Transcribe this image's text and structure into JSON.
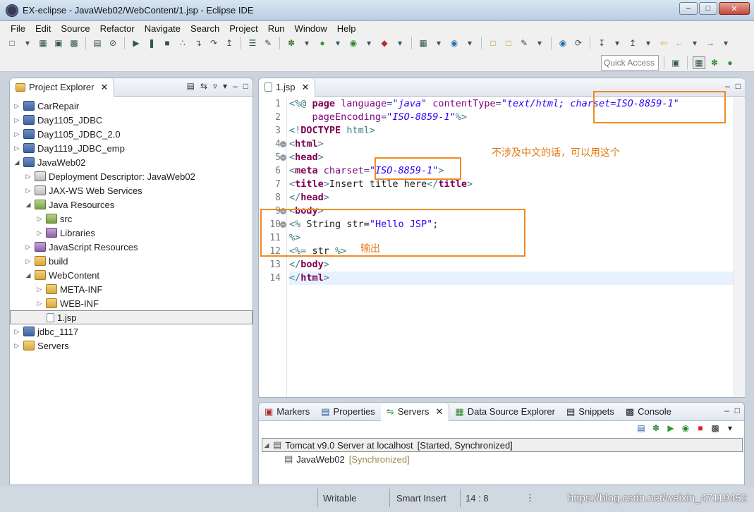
{
  "window": {
    "title": "EX-eclipse - JavaWeb02/WebContent/1.jsp - Eclipse IDE",
    "minimize": "–",
    "maximize": "□",
    "close": "✕"
  },
  "menu": [
    "File",
    "Edit",
    "Source",
    "Refactor",
    "Navigate",
    "Search",
    "Project",
    "Run",
    "Window",
    "Help"
  ],
  "toolbar": {
    "quick_access": "Quick Access"
  },
  "explorer": {
    "tab_label": "Project Explorer",
    "items": [
      {
        "label": "CarRepair",
        "depth": 0,
        "arrow": "▷",
        "icon": "project-icon"
      },
      {
        "label": "Day1105_JDBC",
        "depth": 0,
        "arrow": "▷",
        "icon": "project-icon"
      },
      {
        "label": "Day1105_JDBC_2.0",
        "depth": 0,
        "arrow": "▷",
        "icon": "project-icon"
      },
      {
        "label": "Day1119_JDBC_emp",
        "depth": 0,
        "arrow": "▷",
        "icon": "project-error-icon"
      },
      {
        "label": "JavaWeb02",
        "depth": 0,
        "arrow": "◢",
        "icon": "project-icon"
      },
      {
        "label": "Deployment Descriptor: JavaWeb02",
        "depth": 1,
        "arrow": "▷",
        "icon": "deployment-descriptor-icon"
      },
      {
        "label": "JAX-WS Web Services",
        "depth": 1,
        "arrow": "▷",
        "icon": "webservices-icon"
      },
      {
        "label": "Java Resources",
        "depth": 1,
        "arrow": "◢",
        "icon": "java-resources-icon"
      },
      {
        "label": "src",
        "depth": 2,
        "arrow": "▷",
        "icon": "source-folder-icon"
      },
      {
        "label": "Libraries",
        "depth": 2,
        "arrow": "▷",
        "icon": "libraries-icon"
      },
      {
        "label": "JavaScript Resources",
        "depth": 1,
        "arrow": "▷",
        "icon": "javascript-resources-icon"
      },
      {
        "label": "build",
        "depth": 1,
        "arrow": "▷",
        "icon": "folder-icon"
      },
      {
        "label": "WebContent",
        "depth": 1,
        "arrow": "◢",
        "icon": "folder-icon"
      },
      {
        "label": "META-INF",
        "depth": 2,
        "arrow": "▷",
        "icon": "folder-icon"
      },
      {
        "label": "WEB-INF",
        "depth": 2,
        "arrow": "▷",
        "icon": "folder-icon"
      },
      {
        "label": "1.jsp",
        "depth": 2,
        "arrow": "",
        "icon": "jsp-file-icon",
        "selected": true
      },
      {
        "label": "jdbc_1117",
        "depth": 0,
        "arrow": "▷",
        "icon": "project-icon"
      },
      {
        "label": "Servers",
        "depth": 0,
        "arrow": "▷",
        "icon": "folder-icon"
      }
    ]
  },
  "editor": {
    "tab_label": "1.jsp",
    "line_numbers": [
      "1",
      "2",
      "3",
      "4",
      "5",
      "6",
      "7",
      "8",
      "9",
      "10",
      "11",
      "12",
      "13",
      "14"
    ],
    "lines": [
      [
        [
          "tg",
          "<%@ "
        ],
        [
          "kw",
          "page "
        ],
        [
          "an",
          "language"
        ],
        [
          "tk",
          "="
        ],
        [
          "av",
          "\"java\""
        ],
        [
          "tk",
          " "
        ],
        [
          "an",
          "contentType"
        ],
        [
          "tk",
          "="
        ],
        [
          "av",
          "\"text/html; charset=ISO-8859-1\""
        ]
      ],
      [
        [
          "tk",
          "    "
        ],
        [
          "an",
          "pageEncoding"
        ],
        [
          "tk",
          "="
        ],
        [
          "av",
          "\"ISO-8859-1\""
        ],
        [
          "tg",
          "%>"
        ]
      ],
      [
        [
          "tg",
          "<!"
        ],
        [
          "kw",
          "DOCTYPE"
        ],
        [
          "tk",
          " "
        ],
        [
          "tn",
          "html"
        ],
        [
          "tg",
          ">"
        ]
      ],
      [
        [
          "tg",
          "<"
        ],
        [
          "kw",
          "html"
        ],
        [
          "tg",
          ">"
        ]
      ],
      [
        [
          "tg",
          "<"
        ],
        [
          "kw",
          "head"
        ],
        [
          "tg",
          ">"
        ]
      ],
      [
        [
          "tg",
          "<"
        ],
        [
          "kw",
          "meta"
        ],
        [
          "tk",
          " "
        ],
        [
          "an",
          "charset"
        ],
        [
          "tk",
          "="
        ],
        [
          "av",
          "\"ISO-8859-1\""
        ],
        [
          "tg",
          ">"
        ]
      ],
      [
        [
          "tg",
          "<"
        ],
        [
          "kw",
          "title"
        ],
        [
          "tg",
          ">"
        ],
        [
          "jd",
          "Insert title here"
        ],
        [
          "tg",
          "</"
        ],
        [
          "kw",
          "title"
        ],
        [
          "tg",
          ">"
        ]
      ],
      [
        [
          "tg",
          "</"
        ],
        [
          "kw",
          "head"
        ],
        [
          "tg",
          ">"
        ]
      ],
      [
        [
          "tg",
          "<"
        ],
        [
          "kw",
          "body"
        ],
        [
          "tg",
          ">"
        ]
      ],
      [
        [
          "tg",
          "<%"
        ],
        [
          "jd",
          " String str="
        ],
        [
          "js",
          "\"Hello JSP\""
        ],
        [
          "jd",
          ";"
        ]
      ],
      [
        [
          "tg",
          "%>"
        ]
      ],
      [
        [
          "tg",
          "<%="
        ],
        [
          "jd",
          " str "
        ],
        [
          "tg",
          "%>"
        ]
      ],
      [
        [
          "tg",
          "</"
        ],
        [
          "kw",
          "body"
        ],
        [
          "tg",
          ">"
        ]
      ],
      [
        [
          "tg",
          "</"
        ],
        [
          "kw",
          "html"
        ],
        [
          "tg",
          ">"
        ]
      ]
    ],
    "annotation_1": "不涉及中文的话，可以用这个",
    "annotation_2": "输出",
    "highlight_color": "#f08a24"
  },
  "bottom": {
    "tabs": [
      {
        "label": "Markers",
        "icon": "markers-icon"
      },
      {
        "label": "Properties",
        "icon": "properties-icon"
      },
      {
        "label": "Servers",
        "icon": "servers-icon",
        "active": true
      },
      {
        "label": "Data Source Explorer",
        "icon": "data-source-icon"
      },
      {
        "label": "Snippets",
        "icon": "snippets-icon"
      },
      {
        "label": "Console",
        "icon": "console-icon"
      }
    ],
    "server": "Tomcat v9.0 Server at localhost",
    "server_status": "[Started, Synchronized]",
    "module": "JavaWeb02",
    "module_status": "[Synchronized]"
  },
  "status": {
    "writable": "Writable",
    "insert_mode": "Smart Insert",
    "position": "14 : 8",
    "watermark": "https://blog.csdn.net/weixin_47119452"
  }
}
